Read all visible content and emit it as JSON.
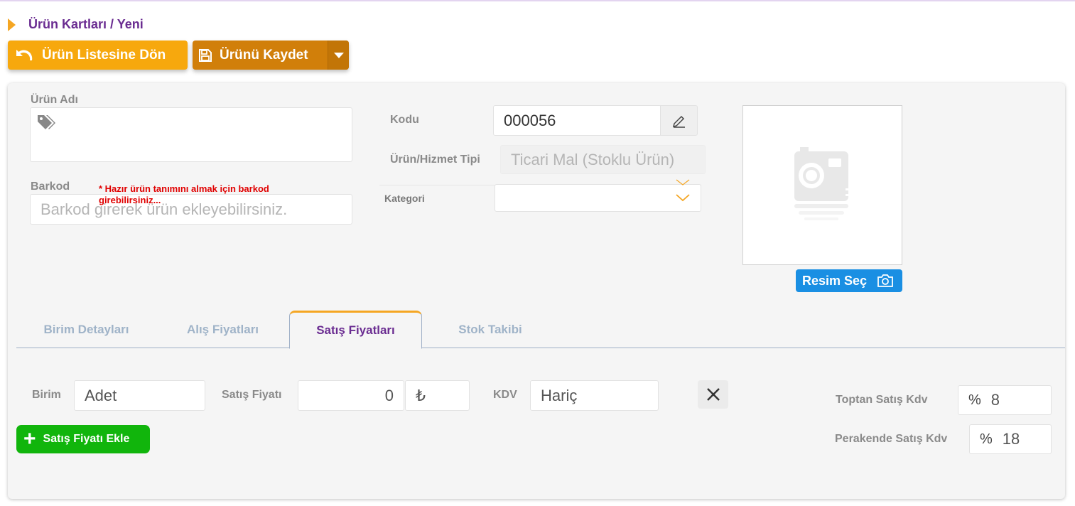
{
  "breadcrumb": {
    "text": "Ürün Kartları / Yeni"
  },
  "toolbar": {
    "back_label": "Ürün Listesine Dön",
    "save_label": "Ürünü Kaydet"
  },
  "form": {
    "urun_adi_label": "Ürün Adı",
    "urun_adi_value": "",
    "barkod_label": "Barkod",
    "barkod_warning": "* Hazır ürün tanımını almak için barkod girebilirsiniz...",
    "barkod_placeholder": "Barkod girerek ürün ekleyebilirsiniz.",
    "kodu_label": "Kodu",
    "kodu_value": "000056",
    "tip_label": "Ürün/Hizmet Tipi",
    "tip_value": "Ticari Mal (Stoklu Ürün)",
    "kategori_label": "Kategori",
    "kategori_value": ""
  },
  "image": {
    "select_label": "Resim Seç"
  },
  "tabs": [
    {
      "label": "Birim Detayları",
      "active": false
    },
    {
      "label": "Alış Fiyatları",
      "active": false
    },
    {
      "label": "Satış Fiyatları",
      "active": true
    },
    {
      "label": "Stok Takibi",
      "active": false
    }
  ],
  "sales": {
    "birim_label": "Birim",
    "birim_value": "Adet",
    "fiyat_label": "Satış Fiyatı",
    "fiyat_value": "0",
    "currency_symbol": "₺",
    "kdv_label": "KDV",
    "kdv_value": "Hariç",
    "add_button_label": "Satış Fiyatı Ekle",
    "toptan_label": "Toptan Satış Kdv",
    "toptan_pct": "%",
    "toptan_value": "8",
    "perakende_label": "Perakende Satış Kdv",
    "perakende_pct": "%",
    "perakende_value": "18"
  },
  "colors": {
    "accent_orange": "#f7a80d",
    "save_orange": "#d17f0a",
    "brand_purple": "#6a2c91",
    "info_blue": "#1a8fe3",
    "success_green": "#11b50c",
    "warning_red": "#e00000"
  },
  "icons": {
    "back": "undo-arrow-icon",
    "save": "floppy-disk-icon",
    "tag": "tag-icon",
    "edit": "pencil-icon",
    "camera": "camera-icon",
    "close": "close-icon",
    "add": "plus-icon"
  }
}
